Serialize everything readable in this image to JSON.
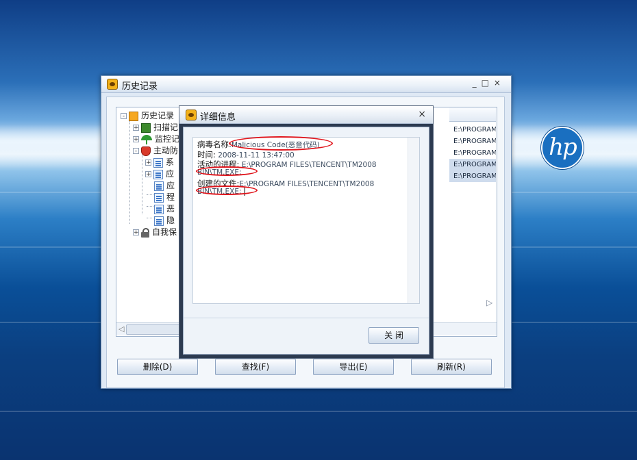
{
  "main_window": {
    "title": "历史记录",
    "controls": "_□×",
    "tree": {
      "root": "历史记录",
      "items": [
        {
          "label": "扫描记",
          "expander": "+"
        },
        {
          "label": "监控记",
          "expander": "+"
        },
        {
          "label": "主动防",
          "expander": "-"
        },
        {
          "label": "系",
          "expander": "+"
        },
        {
          "label": "应",
          "expander": "+"
        },
        {
          "label": "应",
          "expander": ""
        },
        {
          "label": "程",
          "expander": ""
        },
        {
          "label": "恶",
          "expander": ""
        },
        {
          "label": "隐",
          "expander": ""
        },
        {
          "label": "自我保",
          "expander": "+"
        }
      ]
    },
    "list_cells": [
      "E:\\PROGRAM FI",
      "E:\\PROGRAM FI",
      "E:\\PROGRAM FI",
      "E:\\PROGRAM FI",
      "E:\\PROGRAM FI"
    ],
    "buttons": {
      "delete": "删除(D)",
      "find": "查找(F)",
      "export": "导出(E)",
      "refresh": "刷新(R)"
    }
  },
  "dialog": {
    "title": "详细信息",
    "close_glyph": "×",
    "details": {
      "virus_name_label": "病毒名称:",
      "virus_name_value": "Malicious Code(恶意代码)",
      "time_label": "时间:",
      "time_value": "2008-11-11 13:47:00",
      "process_label": "活动的进程:",
      "process_value": "E:\\PROGRAM FILES\\TENCENT\\TM2008",
      "process_cont": "BIN\\TM.EXE;",
      "file_label": "创建的文件:",
      "file_value": "E:\\PROGRAM FILES\\TENCENT\\TM2008",
      "file_cont": "BIN\\TM.EXE;"
    },
    "close_button": "关 闭"
  },
  "wallpaper": {
    "logo_text": "hp",
    "colors": {
      "annotation": "#e0141b",
      "accent": "#1a6fc0"
    }
  }
}
